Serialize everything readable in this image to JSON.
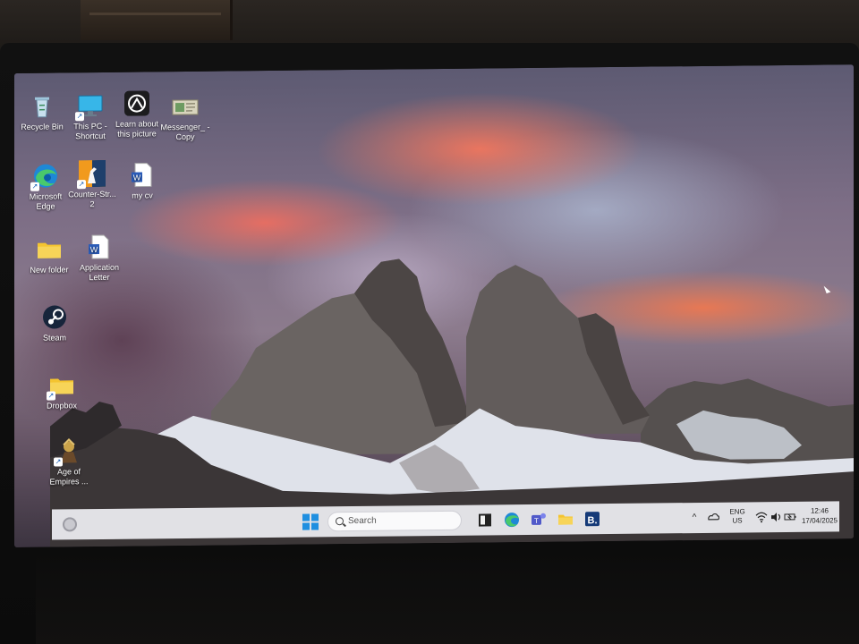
{
  "desktop": {
    "icons": [
      {
        "label": "Recycle Bin",
        "icon": "recycle-bin-icon"
      },
      {
        "label": "This PC - Shortcut",
        "icon": "this-pc-icon"
      },
      {
        "label": "Learn about this picture",
        "icon": "learn-picture-icon"
      },
      {
        "label": "Messenger_ - Copy",
        "icon": "messenger-icon"
      },
      {
        "label": "Microsoft Edge",
        "icon": "edge-icon"
      },
      {
        "label": "Counter-Str... 2",
        "icon": "counter-strike-icon"
      },
      {
        "label": "my cv",
        "icon": "word-doc-icon"
      },
      {
        "label": "New folder",
        "icon": "folder-icon"
      },
      {
        "label": "Application Letter",
        "icon": "word-doc-icon"
      },
      {
        "label": "Steam",
        "icon": "steam-icon"
      },
      {
        "label": "Dropbox",
        "icon": "folder-icon"
      },
      {
        "label": "Age of Empires ...",
        "icon": "age-of-empires-icon"
      }
    ]
  },
  "taskbar": {
    "search_placeholder": "Search",
    "apps": [
      "file-explorer-icon",
      "edge-icon",
      "teams-icon",
      "folder-icon",
      "booking-icon"
    ],
    "language": "ENG",
    "region": "US",
    "time": "12:46",
    "date": "17/04/2025"
  },
  "colors": {
    "taskbar_bg": "#ececf0",
    "windows_blue": "#1f8fe0",
    "folder_yellow": "#f4c430"
  }
}
